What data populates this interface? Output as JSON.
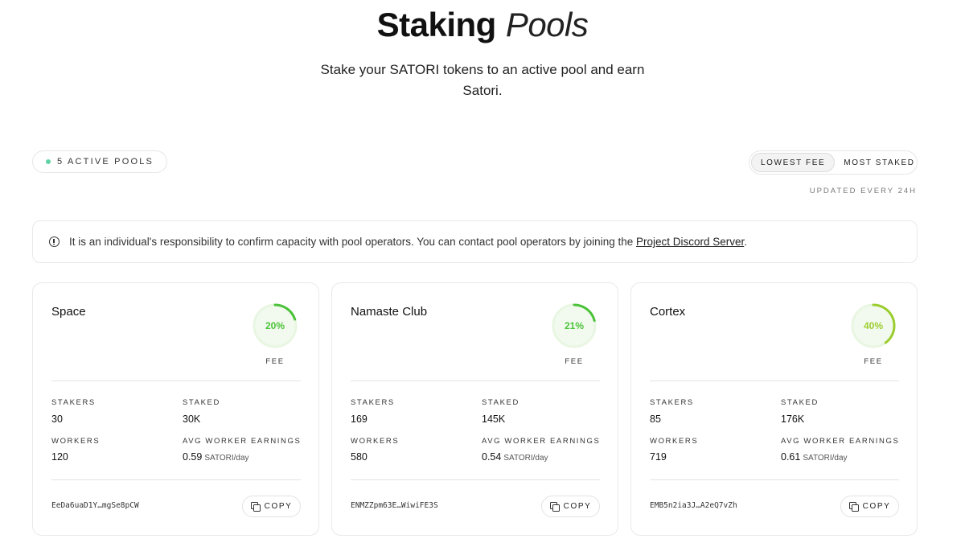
{
  "hero": {
    "title_strong": "Staking",
    "title_light": "Pools",
    "subtitle": "Stake your SATORI tokens to an active pool and earn Satori."
  },
  "filters": {
    "active_pools_label": "5 ACTIVE POOLS",
    "sort_lowest_fee": "LOWEST FEE",
    "sort_most_staked": "MOST STAKED",
    "updated_label": "UPDATED EVERY 24H"
  },
  "notice": {
    "text": "It is an individual's responsibility to confirm capacity with pool operators. You can contact pool operators by joining the ",
    "link_text": "Project Discord Server",
    "suffix": "."
  },
  "labels": {
    "fee": "FEE",
    "stakers": "STAKERS",
    "staked": "STAKED",
    "workers": "WORKERS",
    "avg_worker_earnings": "AVG WORKER EARNINGS",
    "earnings_unit": "SATORI/day",
    "copy": "COPY"
  },
  "colors": {
    "fee_ring_track": "#e8f6e2",
    "fee_ring_fill": "#f2faef",
    "active_dot": "#5fd3a6"
  },
  "pools": [
    {
      "name": "Space",
      "fee_text": "20%",
      "fee_fraction": 0.2,
      "fee_color": "#4cc23a",
      "stakers": "30",
      "staked": "30K",
      "workers": "120",
      "avg_earnings": "0.59",
      "address": "EeDa6uaD1Y…mgSe8pCW"
    },
    {
      "name": "Namaste Club",
      "fee_text": "21%",
      "fee_fraction": 0.21,
      "fee_color": "#4cc23a",
      "stakers": "169",
      "staked": "145K",
      "workers": "580",
      "avg_earnings": "0.54",
      "address": "ENMZZpm63E…WiwiFE3S"
    },
    {
      "name": "Cortex",
      "fee_text": "40%",
      "fee_fraction": 0.4,
      "fee_color": "#9ccd2f",
      "stakers": "85",
      "staked": "176K",
      "workers": "719",
      "avg_earnings": "0.61",
      "address": "EMB5n2ia3J…A2eQ7vZh"
    }
  ]
}
